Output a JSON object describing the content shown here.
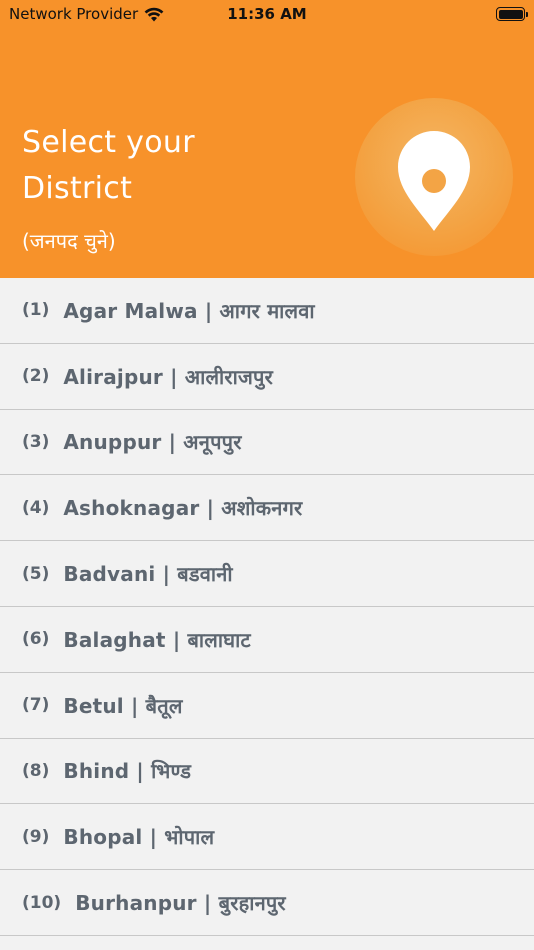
{
  "status_bar": {
    "carrier": "Network Provider",
    "time": "11:36 AM"
  },
  "header": {
    "title_line1": "Select your",
    "title_line2": "District",
    "subtitle": "(जनपद चुने)",
    "accent_color": "#f7922a",
    "icon": "location-pin-icon"
  },
  "districts": [
    {
      "num": "(1)",
      "name": "Agar Malwa | आगर मालवा"
    },
    {
      "num": "(2)",
      "name": "Alirajpur | आलीराजपुर"
    },
    {
      "num": "(3)",
      "name": "Anuppur | अनूपपुर"
    },
    {
      "num": "(4)",
      "name": "Ashoknagar | अशोकनगर"
    },
    {
      "num": "(5)",
      "name": "Badvani | बडवानी"
    },
    {
      "num": "(6)",
      "name": "Balaghat | बालाघाट"
    },
    {
      "num": "(7)",
      "name": "Betul | बैतूल"
    },
    {
      "num": "(8)",
      "name": "Bhind | भिण्ड"
    },
    {
      "num": "(9)",
      "name": "Bhopal | भोपाल"
    },
    {
      "num": "(10)",
      "name": "Burhanpur | बुरहानपुर"
    }
  ]
}
